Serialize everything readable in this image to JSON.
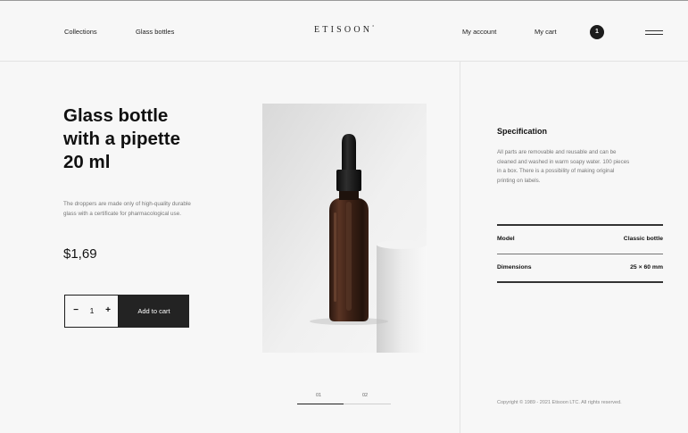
{
  "header": {
    "nav_left": [
      "Collections",
      "Glass bottles"
    ],
    "logo": "ETISOON",
    "logo_mark": "°",
    "nav_right": [
      "My account",
      "My cart"
    ],
    "cart_count": "1",
    "menu_icon": "hamburger-menu-icon"
  },
  "product": {
    "title_lines": [
      "Glass bottle",
      "with a pipette",
      "20 ml"
    ],
    "description": "The droppers are made only of high-quality durable glass with a certificate for pharmacological use.",
    "price": "$1,69",
    "quantity": "1",
    "minus_label": "−",
    "plus_label": "+",
    "add_to_cart": "Add to cart"
  },
  "gallery": {
    "image": "amber-dropper-bottle-photo",
    "slides": [
      "01",
      "02"
    ],
    "active_slide": 1
  },
  "specification": {
    "title": "Specification",
    "text": "All parts are removable and reusable and can be cleaned and washed in warm soapy water. 100 pieces in a box. There is a possibility of making original printing on labels.",
    "rows": [
      {
        "label": "Model",
        "value": "Classic bottle"
      },
      {
        "label": "Dimensions",
        "value": "25 × 60 mm"
      }
    ]
  },
  "footer": {
    "copyright": "Copyright © 1989 - 2021 Etisoon LTC. All rights reserved."
  },
  "colors": {
    "background": "#f7f7f7",
    "dark": "#232323",
    "muted_text": "#777777",
    "bottle_amber": "#3e2216"
  }
}
